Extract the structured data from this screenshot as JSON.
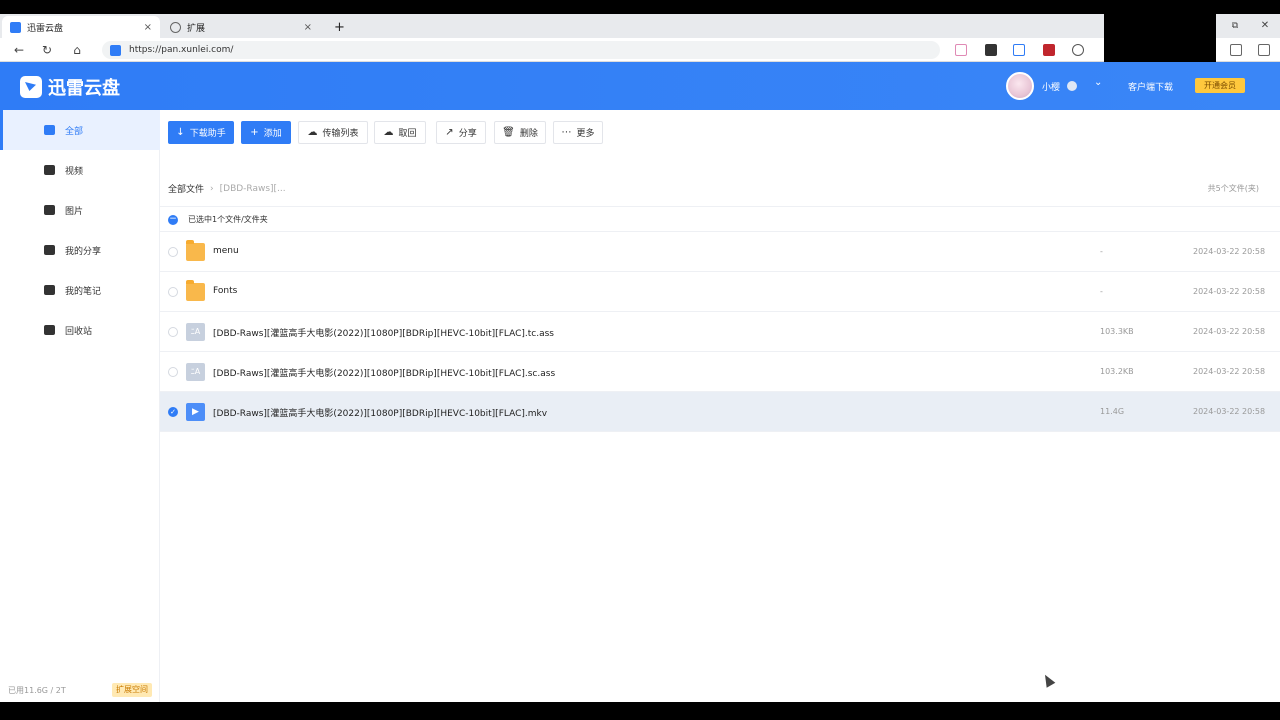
{
  "browser": {
    "tabs": [
      {
        "title": "迅雷云盘",
        "active": true
      },
      {
        "title": "扩展",
        "active": false
      }
    ],
    "new_tab": "+",
    "url": "https://pan.xunlei.com/",
    "close": "×",
    "window_controls": [
      "⧉",
      "✕"
    ]
  },
  "header": {
    "logo": "迅雷云盘",
    "username": "小樱",
    "client_download": "客户端下载",
    "open_vip": "开通会员",
    "chevron": "⌄"
  },
  "sidebar": {
    "items": [
      {
        "label": "全部",
        "icon": "all-files-icon",
        "active": true
      },
      {
        "label": "视频",
        "icon": "video-icon",
        "active": false
      },
      {
        "label": "图片",
        "icon": "image-icon",
        "active": false
      },
      {
        "label": "我的分享",
        "icon": "share-icon",
        "active": false
      },
      {
        "label": "我的笔记",
        "icon": "note-icon",
        "active": false
      },
      {
        "label": "回收站",
        "icon": "trash-icon",
        "active": false
      }
    ],
    "storage": "已用11.6G / 2T",
    "expand": "扩展空间"
  },
  "toolbar": {
    "download_helper": "下载助手",
    "add": "添加",
    "transfer_list": "传输列表",
    "retrieve": "取回",
    "share": "分享",
    "delete": "删除",
    "more": "更多"
  },
  "breadcrumb": {
    "root": "全部文件",
    "current": "[DBD-Raws][..."
  },
  "file_count": "共5个文件(夹)",
  "selection": "已选中1个文件/文件夹",
  "files": [
    {
      "name": "menu",
      "type": "folder",
      "size": "-",
      "date": "2024-03-22 20:58",
      "selected": false
    },
    {
      "name": "Fonts",
      "type": "folder",
      "size": "-",
      "date": "2024-03-22 20:58",
      "selected": false
    },
    {
      "name": "[DBD-Raws][灌篮高手大电影(2022)][1080P][BDRip][HEVC-10bit][FLAC].tc.ass",
      "type": "subtitle",
      "size": "103.3KB",
      "date": "2024-03-22 20:58",
      "selected": false
    },
    {
      "name": "[DBD-Raws][灌篮高手大电影(2022)][1080P][BDRip][HEVC-10bit][FLAC].sc.ass",
      "type": "subtitle",
      "size": "103.2KB",
      "date": "2024-03-22 20:58",
      "selected": false
    },
    {
      "name": "[DBD-Raws][灌篮高手大电影(2022)][1080P][BDRip][HEVC-10bit][FLAC].mkv",
      "type": "video",
      "size": "11.4G",
      "date": "2024-03-22 20:58",
      "selected": true
    }
  ],
  "colors": {
    "brand": "#2f7cf6",
    "vip": "#ffc83d",
    "folder": "#f9b84b"
  }
}
